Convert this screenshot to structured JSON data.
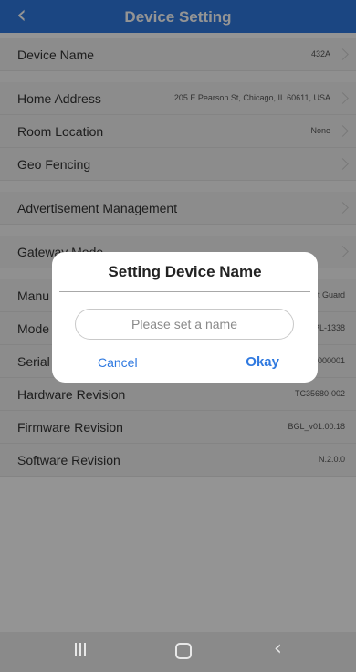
{
  "header": {
    "title": "Device Setting",
    "back_icon": "chevron-left-icon"
  },
  "rows": [
    {
      "label": "Device Name",
      "value": "432A",
      "chevron": true
    },
    {
      "label": "Home Address",
      "value": "205 E Pearson St, Chicago, IL 60611, USA",
      "chevron": true
    },
    {
      "label": "Room Location",
      "value": "None",
      "chevron": true
    },
    {
      "label": "Geo Fencing",
      "value": "",
      "chevron": true
    },
    {
      "label": "Advertisement Management",
      "value": "",
      "chevron": true
    },
    {
      "label": "Gateway Mode",
      "value": "",
      "chevron": true
    },
    {
      "label": "Manu",
      "value": "nt Guard",
      "chevron": false
    },
    {
      "label": "Mode",
      "value": "PL-1338",
      "chevron": false
    },
    {
      "label": "Serial",
      "value": "A000001",
      "chevron": false
    },
    {
      "label": "Hardware Revision",
      "value": "TC35680-002",
      "chevron": false
    },
    {
      "label": "Firmware Revision",
      "value": "BGL_v01.00.18",
      "chevron": false
    },
    {
      "label": "Software Revision",
      "value": "N.2.0.0",
      "chevron": false
    }
  ],
  "dialog": {
    "title": "Setting Device Name",
    "input_placeholder": "Please set a name",
    "input_value": "",
    "cancel_label": "Cancel",
    "okay_label": "Okay"
  },
  "colors": {
    "accent": "#2f79e0",
    "overlay": "rgba(0,0,0,0.42)"
  },
  "navbar": {
    "recent_icon": "recent-apps-icon",
    "home_icon": "home-icon",
    "back_icon": "back-icon"
  }
}
